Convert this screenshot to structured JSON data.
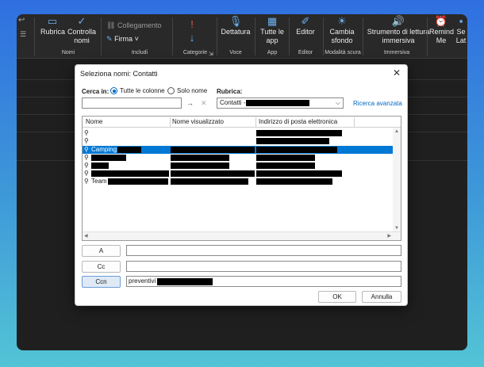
{
  "ribbon": {
    "buttons": [
      {
        "label": "Rubrica",
        "icon": "address-book-icon"
      },
      {
        "label": "Controlla nomi",
        "icon": "check-names-icon"
      },
      {
        "label": "Collegamento",
        "icon": "link-icon"
      },
      {
        "label": "Firma",
        "icon": "signature-icon"
      },
      {
        "label": "Categorie",
        "icon": "flag-icon"
      },
      {
        "label": "Dettatura",
        "icon": "microphone-icon"
      },
      {
        "label": "Tutte le app",
        "icon": "apps-icon"
      },
      {
        "label": "Editor",
        "icon": "editor-icon"
      },
      {
        "label": "Cambia sfondo",
        "icon": "background-icon"
      },
      {
        "label": "Strumento di lettura immersiva",
        "icon": "immersive-reader-icon"
      },
      {
        "label": "Remind Me",
        "icon": "remind-icon"
      },
      {
        "label": "Se Lat",
        "icon": "more-icon"
      }
    ],
    "groups": [
      "Nomi",
      "Includi",
      "Voce",
      "App",
      "Editor",
      "Modalità scura",
      "Immersiva"
    ]
  },
  "dialog": {
    "title": "Seleziona nomi: Contatti",
    "search_label": "Cerca in:",
    "radio_all": "Tutte le colonne",
    "radio_name": "Solo nome",
    "addressbook_label": "Rubrica:",
    "addressbook_value": "Contatti - ",
    "advanced_link": "Ricerca avanzata",
    "search_value": "",
    "columns": [
      "Nome",
      "Nome visualizzato",
      "Indirizzo di posta elettronica"
    ],
    "rows": [
      {
        "name": ""
      },
      {
        "name": ""
      },
      {
        "name": "Camping"
      },
      {
        "name": ""
      },
      {
        "name": ""
      },
      {
        "name": ""
      },
      {
        "name": "Team"
      }
    ],
    "to_label": "A",
    "cc_label": "Cc",
    "bcc_label": "Ccn",
    "to_value": "",
    "cc_value": "",
    "bcc_value": "preventivi",
    "ok_label": "OK",
    "cancel_label": "Annulla"
  }
}
